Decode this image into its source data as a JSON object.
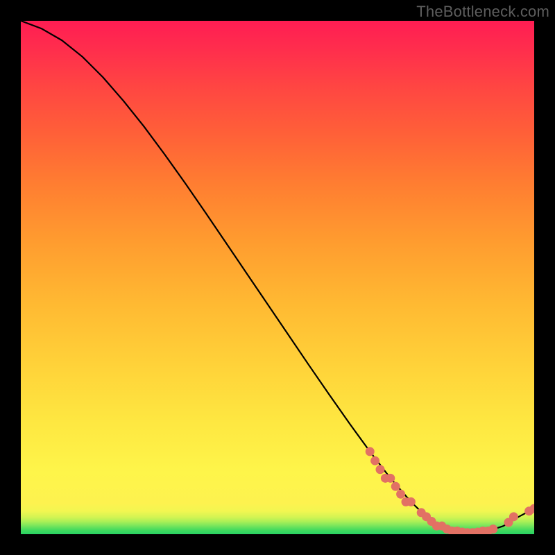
{
  "watermark": "TheBottleneck.com",
  "chart_data": {
    "type": "line",
    "title": "",
    "xlabel": "",
    "ylabel": "",
    "xlim": [
      0,
      100
    ],
    "ylim": [
      0,
      100
    ],
    "curve": {
      "x": [
        0,
        4,
        8,
        12,
        16,
        20,
        24,
        28,
        32,
        36,
        40,
        44,
        48,
        52,
        56,
        60,
        64,
        68,
        72,
        76,
        79,
        82,
        85,
        88,
        91,
        94,
        97,
        100
      ],
      "y": [
        100,
        98.5,
        96.2,
        93.0,
        89.0,
        84.4,
        79.4,
        74.0,
        68.4,
        62.6,
        56.7,
        50.8,
        44.9,
        39.0,
        33.1,
        27.3,
        21.6,
        16.1,
        10.9,
        6.3,
        3.4,
        1.6,
        0.6,
        0.3,
        0.6,
        1.6,
        3.4,
        5.0
      ]
    },
    "markers": {
      "x": [
        68,
        69,
        70,
        71,
        72,
        73,
        74,
        75,
        76,
        78,
        79,
        80,
        81,
        82,
        83,
        84,
        85,
        86,
        87,
        88,
        89,
        90,
        91,
        92,
        95,
        96,
        99,
        100
      ],
      "y": [
        16.1,
        14.3,
        12.6,
        10.9,
        10.9,
        9.3,
        7.8,
        6.3,
        6.3,
        4.2,
        3.4,
        2.5,
        1.6,
        1.6,
        1.0,
        0.6,
        0.6,
        0.4,
        0.3,
        0.3,
        0.4,
        0.6,
        0.6,
        1.0,
        2.3,
        3.4,
        4.5,
        5.0
      ]
    },
    "marker_color": "#e27164",
    "line_color": "#000000"
  }
}
